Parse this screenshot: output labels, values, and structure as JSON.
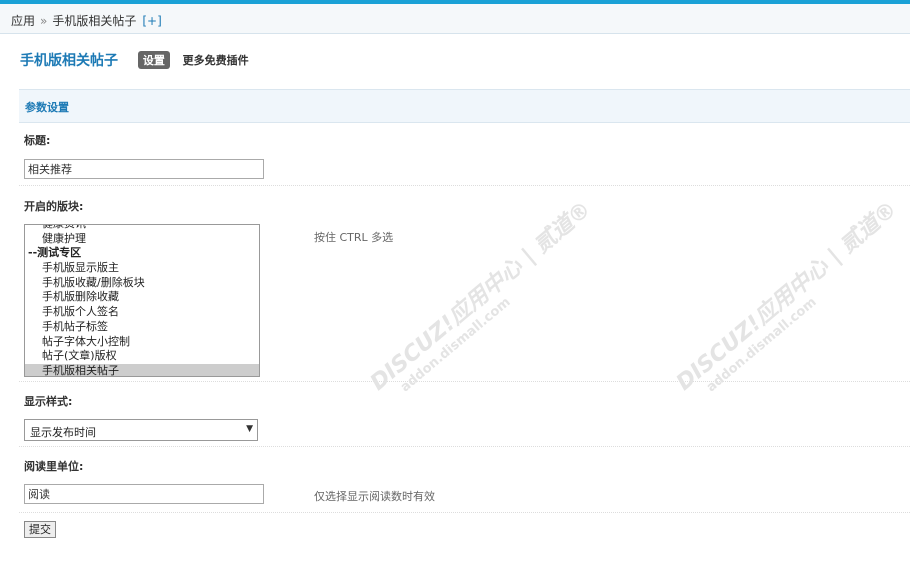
{
  "breadcrumb": {
    "root": "应用",
    "separator": "»",
    "current": "手机版相关帖子",
    "add": "[+]"
  },
  "header": {
    "plugin_title": "手机版相关帖子",
    "tab_settings": "设置",
    "tab_more": "更多免费插件"
  },
  "section": {
    "title": "参数设置"
  },
  "form": {
    "title_label": "标题:",
    "title_value": "相关推荐",
    "forums_label": "开启的版块:",
    "forums_hint": "按住 CTRL 多选",
    "forums_options": [
      {
        "label": "健康资讯",
        "type": "item",
        "selected": false
      },
      {
        "label": "健康护理",
        "type": "item",
        "selected": false
      },
      {
        "label": "--测试专区",
        "type": "group",
        "selected": false
      },
      {
        "label": "手机版显示版主",
        "type": "item",
        "selected": false
      },
      {
        "label": "手机版收藏/删除板块",
        "type": "item",
        "selected": false
      },
      {
        "label": "手机版删除收藏",
        "type": "item",
        "selected": false
      },
      {
        "label": "手机版个人签名",
        "type": "item",
        "selected": false
      },
      {
        "label": "手机帖子标签",
        "type": "item",
        "selected": false
      },
      {
        "label": "帖子字体大小控制",
        "type": "item",
        "selected": false
      },
      {
        "label": "帖子(文章)版权",
        "type": "item",
        "selected": false
      },
      {
        "label": "手机版相关帖子",
        "type": "item",
        "selected": true
      }
    ],
    "style_label": "显示样式:",
    "style_value": "显示发布时间",
    "unit_label": "阅读里单位:",
    "unit_value": "阅读",
    "unit_hint": "仅选择显示阅读数时有效",
    "submit_label": "提交"
  },
  "watermark": {
    "line1": "DISCUZ!应用中心 | 贰道®",
    "line2": "addon.dismall.com"
  }
}
